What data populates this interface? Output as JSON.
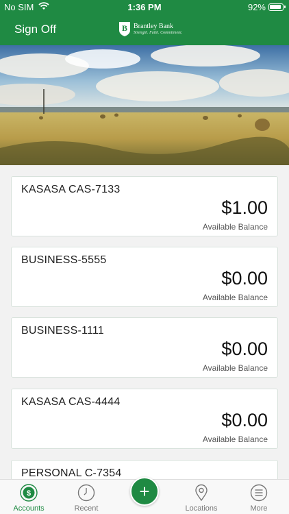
{
  "status_bar": {
    "carrier": "No SIM",
    "time": "1:36 PM",
    "battery": "92%"
  },
  "header": {
    "sign_off_label": "Sign Off",
    "logo_letter": "B",
    "bank_name": "Brantley Bank",
    "tagline": "Strength. Faith. Commitment.",
    "brand_color": "#1f8a43"
  },
  "accounts": [
    {
      "name": "KASASA CAS-7133",
      "amount": "$1.00",
      "caption": "Available Balance"
    },
    {
      "name": "BUSINESS-5555",
      "amount": "$0.00",
      "caption": "Available Balance"
    },
    {
      "name": "BUSINESS-1111",
      "amount": "$0.00",
      "caption": "Available Balance"
    },
    {
      "name": "KASASA CAS-4444",
      "amount": "$0.00",
      "caption": "Available Balance"
    },
    {
      "name": "PERSONAL C-7354",
      "amount": "",
      "caption": ""
    }
  ],
  "tab_bar": {
    "accounts": {
      "label": "Accounts",
      "icon": "dollar-circle-icon",
      "active": true
    },
    "recent": {
      "label": "Recent",
      "icon": "clock-icon"
    },
    "add": {
      "icon": "plus-icon",
      "glyph": "+"
    },
    "locations": {
      "label": "Locations",
      "icon": "map-pin-icon"
    },
    "more": {
      "label": "More",
      "icon": "menu-icon"
    }
  }
}
